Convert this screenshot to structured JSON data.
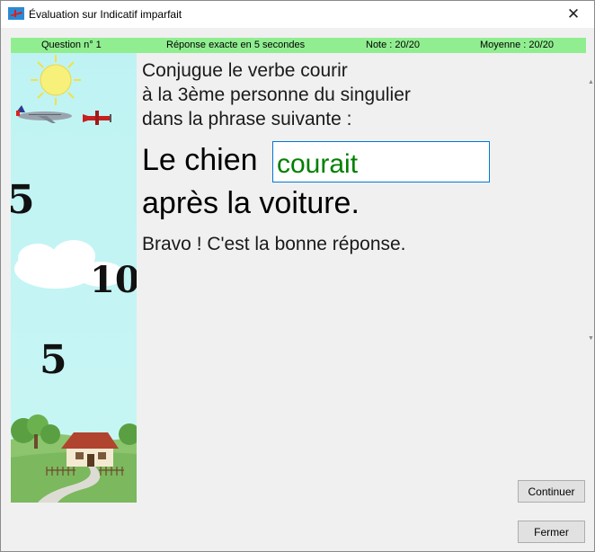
{
  "window": {
    "title": "Évaluation sur Indicatif imparfait",
    "close_glyph": "✕"
  },
  "status": {
    "question": "Question n° 1",
    "response_time": "Réponse exacte en 5 secondes",
    "score": "Note : 20/20",
    "average": "Moyenne : 20/20",
    "background_color": "#90ee90"
  },
  "side_panel": {
    "numbers": [
      "5",
      "10",
      "5"
    ],
    "sky_color": "#c4f4f4",
    "sun_color": "#f5ef6a",
    "icons": [
      "sun-icon",
      "airliner-icon",
      "biplane-icon",
      "cloud-icon",
      "house-icon",
      "tree-icon"
    ]
  },
  "exercise": {
    "prompt_lines": [
      "Conjugue le verbe courir",
      "à la 3ème personne du singulier",
      "dans la phrase suivante :"
    ],
    "sentence_start": "Le chien",
    "answer_value": "courait",
    "sentence_end": "après la voiture.",
    "feedback": "Bravo ! C'est la bonne réponse.",
    "answer_color": "#008000"
  },
  "buttons": {
    "continue_label": "Continuer",
    "close_label": "Fermer"
  }
}
